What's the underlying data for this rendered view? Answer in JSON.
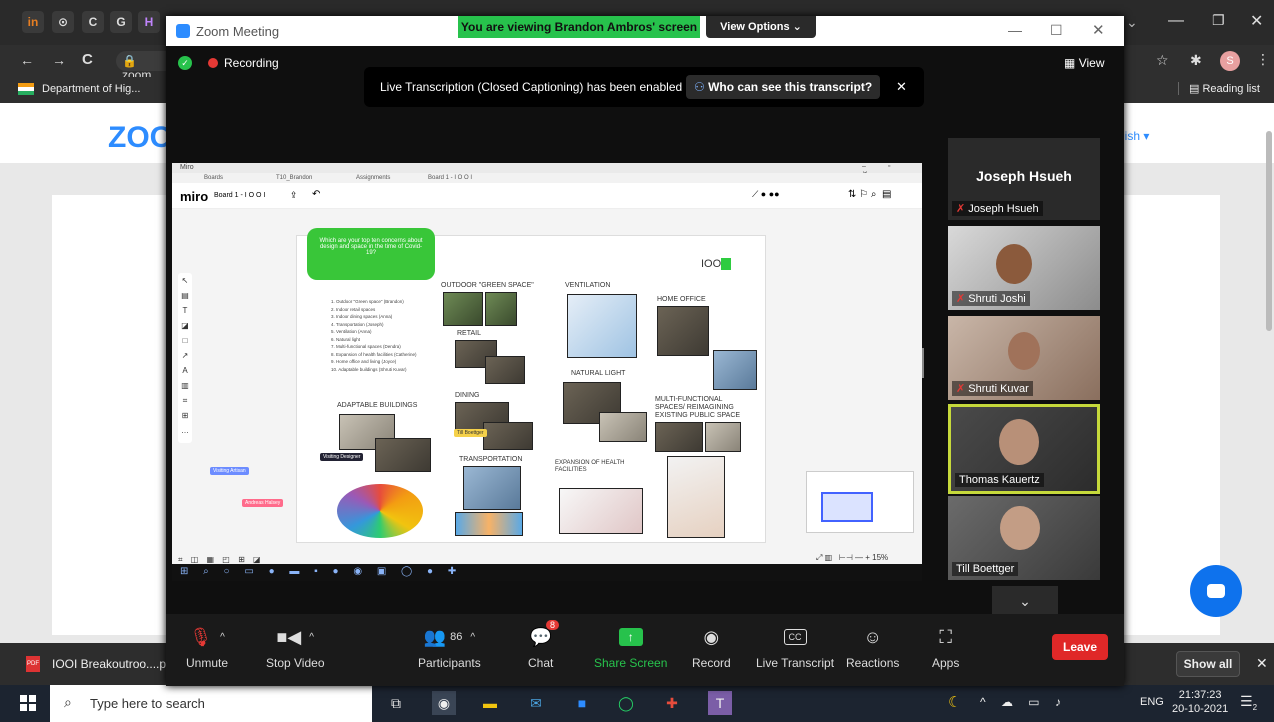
{
  "chrome": {
    "tab_icons": [
      "in",
      "⊙",
      "C",
      "G",
      "H"
    ],
    "address": "zoom",
    "bookmark_1": "Department of Hig...",
    "reading_list": "Reading list",
    "profile_initial": "S"
  },
  "webpage": {
    "logo": "ZOO",
    "language": "lish ▾"
  },
  "zoom": {
    "window_title": "Zoom Meeting",
    "viewing_banner": "You are viewing Brandon Ambros' screen",
    "view_options": "View Options ⌄",
    "recording": "Recording",
    "view_button": "View",
    "transcript_notice": "Live Transcription (Closed Captioning) has been enabled",
    "transcript_link": "Who can see this transcript?",
    "participants_count": "86",
    "chat_badge": "8",
    "controls": {
      "unmute": "Unmute",
      "stop_video": "Stop Video",
      "participants": "Participants",
      "chat": "Chat",
      "share_screen": "Share Screen",
      "record": "Record",
      "live_transcript": "Live Transcript",
      "reactions": "Reactions",
      "apps": "Apps",
      "leave": "Leave"
    },
    "speaker_name": "Joseph Hsueh",
    "participants": [
      {
        "name": "Joseph Hsueh"
      },
      {
        "name": "Shruti Joshi"
      },
      {
        "name": "Shruti Kuvar"
      },
      {
        "name": "Thomas Kauertz"
      },
      {
        "name": "Till Boettger"
      }
    ]
  },
  "miro": {
    "app_name": "Miro",
    "tabs": [
      "Boards",
      "T10_Brandon",
      "Assignments",
      "Board 1 - I O O I"
    ],
    "logo": "miro",
    "board_name": "Board 1 - I O O I",
    "zoom_level": "15%",
    "sticky_text": "Which are your top ten concerns about design and space in the time of Covid-19?",
    "list_items": [
      "1. Outdoor \"Green space\" (Brandon)",
      "2. Indoor retail spaces",
      "3. Indoor dining spaces (Anna)",
      "4. Transportation (Joseph)",
      "5. Ventilation (Anna)",
      "6. Natural light",
      "7. Multi-functional spaces (Dendra)",
      "8. Expansion of health facilities (Catherine)",
      "9. Home office and living (Joyce)",
      "10. Adaptable buildings (Shruti Kuvar)"
    ],
    "labels": {
      "outdoor": "OUTDOOR \"GREEN SPACE\"",
      "ventilation": "VENTILATION",
      "home_office": "HOME OFFICE",
      "retail": "RETAIL",
      "natural_light": "NATURAL LIGHT",
      "dining": "DINING",
      "multi": "MULTI-FUNCTIONAL SPACES/ REIMAGINING EXISTING PUBLIC SPACE",
      "adaptable": "ADAPTABLE BUILDINGS",
      "transportation": "TRANSPORTATION",
      "health": "EXPANSION OF HEALTH FACILITIES",
      "ioo": "IOO"
    },
    "cursors": [
      {
        "name": "Visiting Artisan"
      },
      {
        "name": "Andreas Halsey"
      },
      {
        "name": "Visiting Designer"
      },
      {
        "name": "Till Boettger"
      }
    ],
    "colors": {
      "sticky": "#39c639",
      "green_accent": "#2ecc40"
    }
  },
  "downloads": {
    "file": "IOOI Breakoutroo....p",
    "show_all": "Show all"
  },
  "taskbar": {
    "search_placeholder": "Type here to search",
    "language": "ENG",
    "time": "21:37:23",
    "date": "20-10-2021",
    "notification_count": "2"
  }
}
